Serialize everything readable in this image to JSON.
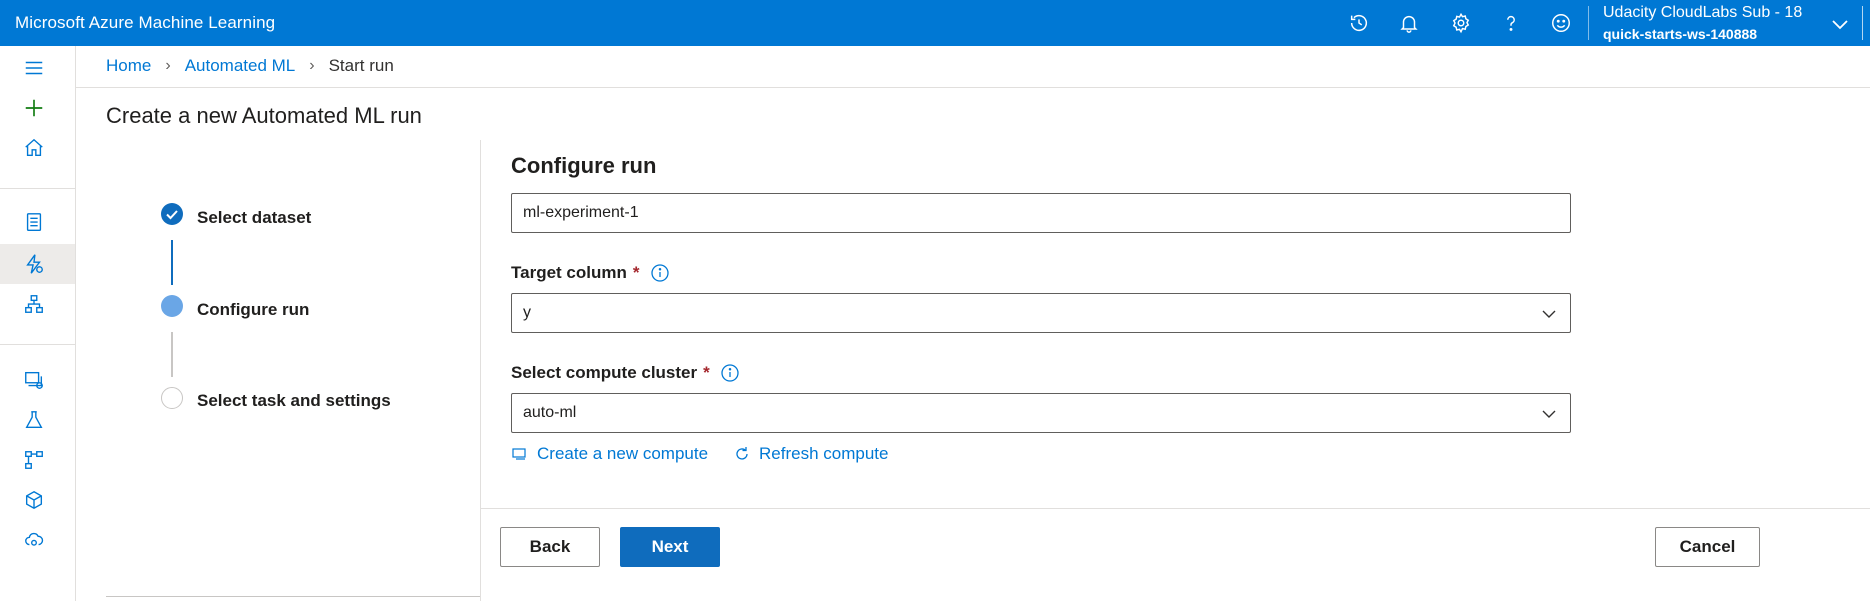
{
  "header": {
    "app_title": "Microsoft Azure Machine Learning",
    "icons": [
      "history-icon",
      "bell-icon",
      "gear-icon",
      "help-icon",
      "smiley-icon"
    ],
    "account_name": "Udacity CloudLabs Sub - 18",
    "workspace_name": "quick-starts-ws-140888"
  },
  "sidebar": {
    "items": [
      "hamburger-icon",
      "add-icon",
      "home-icon",
      "notebook-icon",
      "automl-icon",
      "designer-icon",
      "datasets-icon",
      "experiments-icon",
      "pipelines-icon",
      "models-icon",
      "endpoints-icon"
    ],
    "selected": "automl-icon"
  },
  "breadcrumb": {
    "home": "Home",
    "automl": "Automated ML",
    "current": "Start run"
  },
  "page": {
    "title": "Create a new Automated ML run"
  },
  "wizard": {
    "steps": [
      {
        "label": "Select dataset",
        "state": "completed"
      },
      {
        "label": "Configure run",
        "state": "current"
      },
      {
        "label": "Select task and settings",
        "state": "pending"
      }
    ]
  },
  "form": {
    "section_title": "Configure run",
    "experiment_name": "ml-experiment-1",
    "target_column_label": "Target column",
    "target_column_value": "y",
    "compute_label": "Select compute cluster",
    "compute_value": "auto-ml",
    "required_mark": "*",
    "create_compute_link": "Create a new compute",
    "refresh_compute_link": "Refresh compute"
  },
  "footer": {
    "back_label": "Back",
    "next_label": "Next",
    "cancel_label": "Cancel"
  },
  "colors": {
    "brand": "#0078d4",
    "primary_button": "#0f6cbd",
    "required": "#a4262c"
  }
}
